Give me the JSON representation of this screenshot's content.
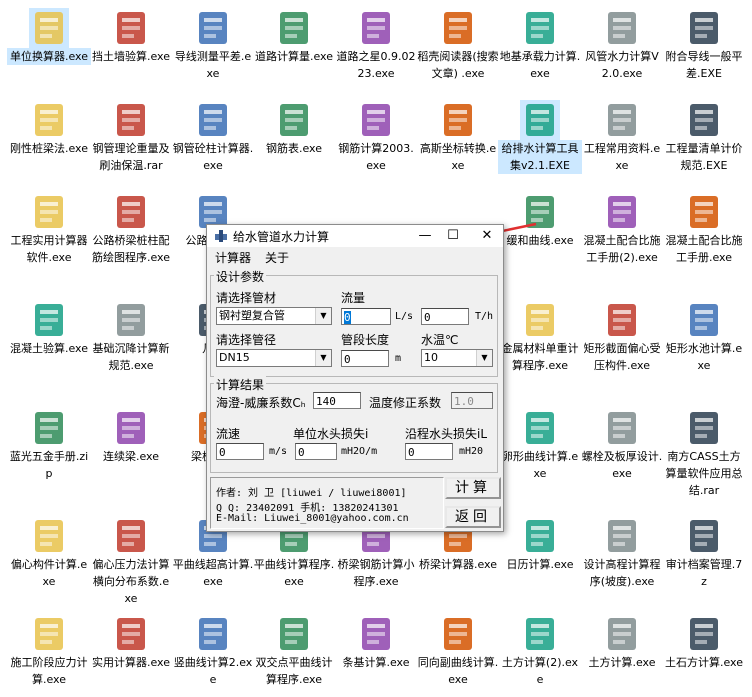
{
  "desktop": {
    "icons": [
      {
        "label": "单位换算器.exe"
      },
      {
        "label": "挡土墙验算.exe"
      },
      {
        "label": "导线测量平差.exe"
      },
      {
        "label": "道路计算量.exe"
      },
      {
        "label": "道路之星0.9.0223.exe"
      },
      {
        "label": "稻壳阅读器(搜索文章) .exe"
      },
      {
        "label": "地基承载力计算.exe"
      },
      {
        "label": "风管水力计算V2.0.exe"
      },
      {
        "label": "附合导线一般平差.EXE"
      },
      {
        "label": "刚性桩梁法.exe"
      },
      {
        "label": "钢管理论重量及刷油保温.rar"
      },
      {
        "label": "钢管砼柱计算器.exe"
      },
      {
        "label": "钢筋表.exe"
      },
      {
        "label": "钢筋计算2003.exe"
      },
      {
        "label": "高斯坐标转换.exe"
      },
      {
        "label": "给排水计算工具集v2.1.EXE"
      },
      {
        "label": "工程常用资料.exe"
      },
      {
        "label": "工程量清单计价规范.EXE"
      },
      {
        "label": "工程实用计算器软件.exe"
      },
      {
        "label": "公路桥梁桩柱配筋绘图程序.exe"
      },
      {
        "label": "公路桥梁系"
      },
      {
        "label": "缓和曲线.exe"
      },
      {
        "label": "混凝土配合比施工手册(2).exe"
      },
      {
        "label": "混凝土配合比施工手册.exe"
      },
      {
        "label": "混凝土验算.exe"
      },
      {
        "label": "基础沉降计算新规范.exe"
      },
      {
        "label": "几何"
      },
      {
        "label": "金属材料单重计算程序.exe"
      },
      {
        "label": "矩形截面偏心受压构件.exe"
      },
      {
        "label": "矩形水池计算.exe"
      },
      {
        "label": "蓝光五金手册.zip"
      },
      {
        "label": "连续梁.exe"
      },
      {
        "label": "梁板积查"
      },
      {
        "label": "卵形曲线计算.exe"
      },
      {
        "label": "螺栓及板厚设计.exe"
      },
      {
        "label": "南方CASS土方算量软件应用总结.rar"
      },
      {
        "label": "偏心构件计算.exe"
      },
      {
        "label": "偏心压力法计算横向分布系数.exe"
      },
      {
        "label": "平曲线超高计算.exe"
      },
      {
        "label": "平曲线计算程序.exe"
      },
      {
        "label": "桥梁钢筋计算小程序.exe"
      },
      {
        "label": "桥梁计算器.exe"
      },
      {
        "label": "日历计算.exe"
      },
      {
        "label": "设计高程计算程序(坡度).exe"
      },
      {
        "label": "审计档案管理.7z"
      },
      {
        "label": "施工阶段应力计算.exe"
      },
      {
        "label": "实用计算器.exe"
      },
      {
        "label": "竖曲线计算2.exe"
      },
      {
        "label": "双交点平曲线计算程序.exe"
      },
      {
        "label": "条基计算.exe"
      },
      {
        "label": "同向副曲线计算.exe"
      },
      {
        "label": "土方计算(2).exe"
      },
      {
        "label": "土方计算.exe"
      },
      {
        "label": "土石方计算.exe"
      }
    ]
  },
  "dialog": {
    "title": "给水管道水力计算",
    "menu": [
      "计算器",
      "关于"
    ],
    "design_group": "设计参数",
    "pipe_material_label": "请选择管材",
    "pipe_material_value": "钢衬塑复合管",
    "flow_label": "流量",
    "flow_ls_value": "0",
    "flow_ls_unit": "L/s",
    "flow_th_value": "0",
    "flow_th_unit": "T/h",
    "pipe_dia_label": "请选择管径",
    "pipe_dia_value": "DN15",
    "length_label": "管段长度",
    "length_value": "0",
    "length_unit": "m",
    "temp_label": "水温℃",
    "temp_value": "10",
    "result_group": "计算结果",
    "hw_label": "海澄-威廉系数Cₕ",
    "hw_value": "140",
    "temp_coef_label": "温度修正系数",
    "temp_coef_value": "1.0",
    "velocity_label": "流速",
    "velocity_value": "0",
    "velocity_unit": "m/s",
    "unit_loss_label": "单位水头损失i",
    "unit_loss_value": "0",
    "unit_loss_unit": "mH2O/m",
    "path_loss_label": "沿程水头损失iL",
    "path_loss_value": "0",
    "path_loss_unit": "mH20",
    "author_line": "作者: 刘 卫 [liuwei / liuwei8001]",
    "contact_line": "Q  Q: 23402091  手机: 13820241301",
    "email_line": "E-Mail: Liuwei_8001@yahoo.com.cn",
    "calc_button": "计算",
    "back_button": "返回"
  },
  "colors": {
    "arrow": "#e03030",
    "selection": "#cce8ff"
  }
}
